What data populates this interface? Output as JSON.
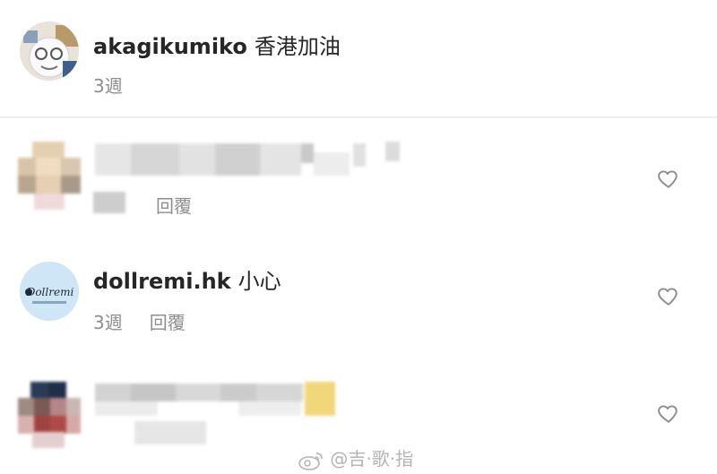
{
  "comments": [
    {
      "username": "akagikumiko",
      "text": "香港加油",
      "time": "3週",
      "avatar": "cartoon-character-avatar"
    },
    {
      "username": "",
      "text": "",
      "time": "3週",
      "reply": "回覆",
      "blurred": true,
      "avatar": "blurred-avatar",
      "like_icon": "heart-outline-icon"
    },
    {
      "username": "dollremi.hk",
      "text": "小心",
      "time": "3週",
      "reply": "回覆",
      "avatar": "dollremi-logo-avatar",
      "avatar_logo_text": "Dollremi",
      "like_icon": "heart-outline-icon"
    },
    {
      "username": "",
      "text": "",
      "blurred": true,
      "avatar": "blurred-avatar",
      "like_icon": "heart-outline-icon"
    }
  ],
  "watermark": {
    "icon": "weibo-logo-icon",
    "text": "@吉·歌·指"
  },
  "colors": {
    "username": "#262626",
    "meta": "#8e8e8e",
    "heart_outline": "#8e8e8e",
    "divider": "#efefef",
    "dollremi_avatar_bg": "#cfe6f6"
  }
}
